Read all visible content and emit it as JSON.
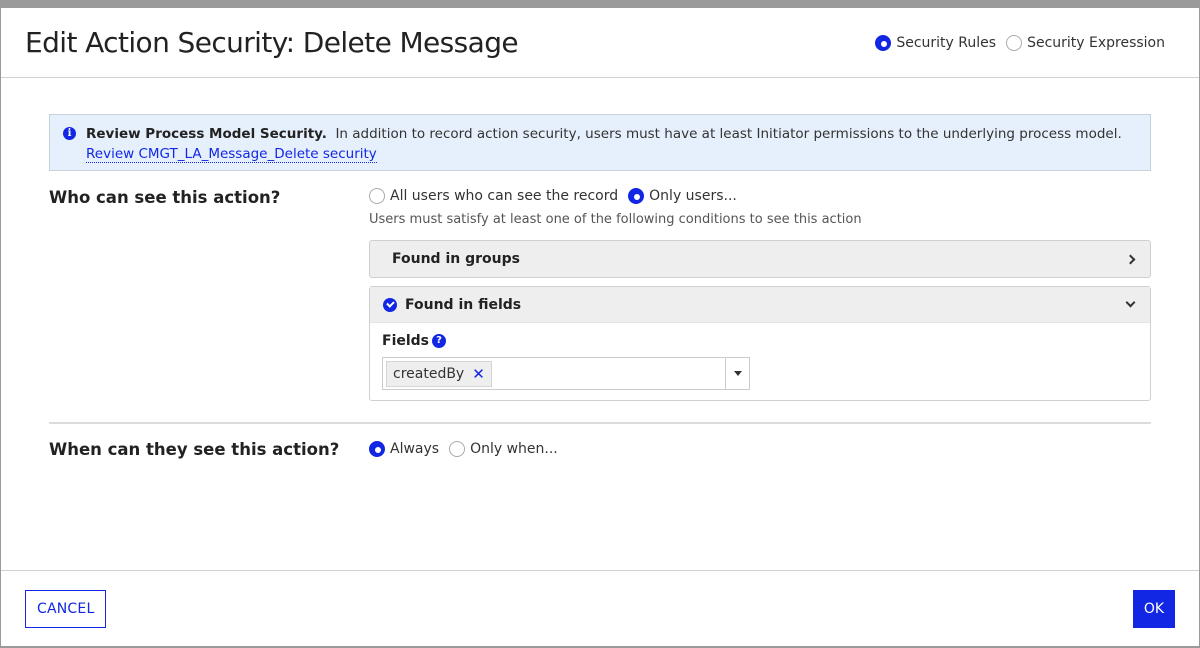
{
  "dialog": {
    "title": "Edit Action Security: Delete Message",
    "mode": {
      "options": [
        {
          "label": "Security Rules",
          "selected": true
        },
        {
          "label": "Security Expression",
          "selected": false
        }
      ]
    }
  },
  "info": {
    "icon": "info-icon",
    "bold": "Review Process Model Security.",
    "text": "In addition to record action security, users must have at least Initiator permissions to the underlying process model.",
    "link": "Review CMGT_LA_Message_Delete security"
  },
  "who": {
    "label": "Who can see this action?",
    "options": [
      {
        "label": "All users who can see the record",
        "selected": false
      },
      {
        "label": "Only users...",
        "selected": true
      }
    ],
    "hint": "Users must satisfy at least one of the following conditions to see this action",
    "sections": [
      {
        "label": "Found in groups",
        "expanded": false,
        "checked": false
      },
      {
        "label": "Found in fields",
        "expanded": true,
        "checked": true
      }
    ],
    "fields": {
      "label": "Fields",
      "help_icon": "question-circle-icon",
      "selected": [
        "createdBy"
      ]
    }
  },
  "when": {
    "label": "When can they see this action?",
    "options": [
      {
        "label": "Always",
        "selected": true
      },
      {
        "label": "Only when...",
        "selected": false
      }
    ]
  },
  "footer": {
    "cancel_label": "CANCEL",
    "ok_label": "OK"
  },
  "colors": {
    "accent": "#1127e3",
    "info_bg": "#e6f0fc",
    "section_bg": "#eeeeee"
  }
}
